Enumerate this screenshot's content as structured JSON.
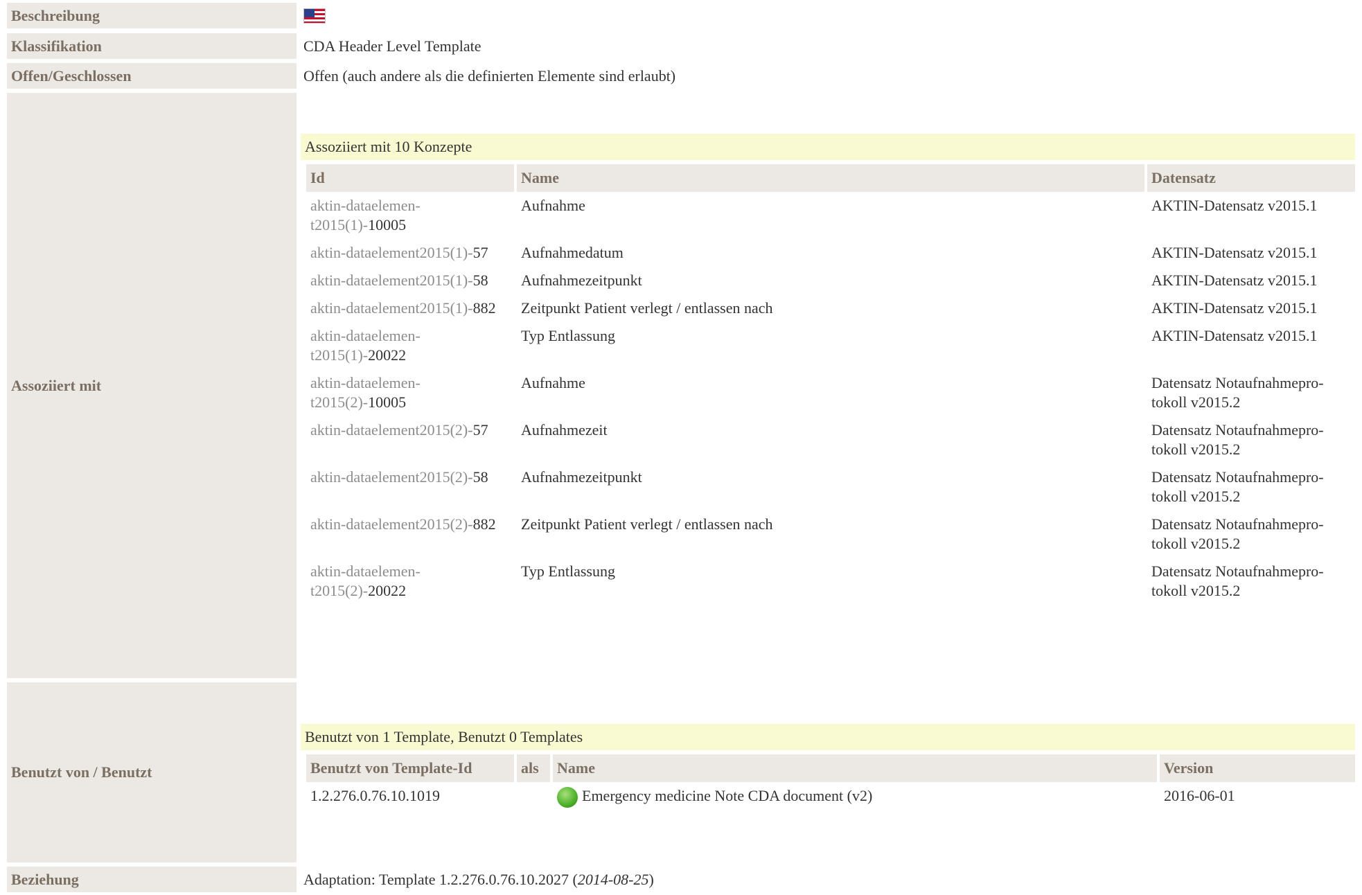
{
  "rows": {
    "beschreibung": {
      "label": "Beschreibung",
      "flag_icon": "us-flag-icon"
    },
    "klassifikation": {
      "label": "Klassifikation",
      "value": "CDA Header Level Template"
    },
    "offen": {
      "label": "Offen/Geschlossen",
      "value": "Offen (auch andere als die definierten Elemente sind erlaubt)"
    },
    "assoziiert": {
      "label": "Assoziiert mit"
    },
    "benutzt": {
      "label": "Benutzt von / Benutzt"
    },
    "beziehung": {
      "label": "Beziehung",
      "prefix": "Adaptation: Template 1.2.276.0.76.10.2027 (",
      "date": "2014-08-25",
      "suffix": ")"
    }
  },
  "concepts": {
    "caption": "Assoziiert mit 10 Konzepte",
    "headers": [
      "Id",
      "Name",
      "Datensatz"
    ],
    "items": [
      {
        "id_prefix": "aktin-dataelemen-",
        "id_break": "t2015(1)-",
        "id_num": "10005",
        "name": "Aufnahme",
        "dataset": "AKTIN-Datensatz v2015.1",
        "dataset2": ""
      },
      {
        "id_prefix": "aktin-dataelement2015(1)-",
        "id_break": "",
        "id_num": "57",
        "name": "Aufnahmedatum",
        "dataset": "AKTIN-Datensatz v2015.1",
        "dataset2": ""
      },
      {
        "id_prefix": "aktin-dataelement2015(1)-",
        "id_break": "",
        "id_num": "58",
        "name": "Aufnahmezeitpunkt",
        "dataset": "AKTIN-Datensatz v2015.1",
        "dataset2": ""
      },
      {
        "id_prefix": "aktin-dataelement2015(1)-",
        "id_break": "",
        "id_num": "882",
        "name": "Zeitpunkt Patient verlegt / entlassen nach",
        "dataset": "AKTIN-Datensatz v2015.1",
        "dataset2": ""
      },
      {
        "id_prefix": "aktin-dataelemen-",
        "id_break": "t2015(1)-",
        "id_num": "20022",
        "name": "Typ Entlassung",
        "dataset": "AKTIN-Datensatz v2015.1",
        "dataset2": ""
      },
      {
        "id_prefix": "aktin-dataelemen-",
        "id_break": "t2015(2)-",
        "id_num": "10005",
        "name": "Aufnahme",
        "dataset": "Datensatz Notaufnahmepro-",
        "dataset2": "tokoll v2015.2"
      },
      {
        "id_prefix": "aktin-dataelement2015(2)-",
        "id_break": "",
        "id_num": "57",
        "name": "Aufnahmezeit",
        "dataset": "Datensatz Notaufnahmepro-",
        "dataset2": "tokoll v2015.2"
      },
      {
        "id_prefix": "aktin-dataelement2015(2)-",
        "id_break": "",
        "id_num": "58",
        "name": "Aufnahmezeitpunkt",
        "dataset": "Datensatz Notaufnahmepro-",
        "dataset2": "tokoll v2015.2"
      },
      {
        "id_prefix": "aktin-dataelement2015(2)-",
        "id_break": "",
        "id_num": "882",
        "name": "Zeitpunkt Patient verlegt / entlassen nach",
        "dataset": "Datensatz Notaufnahmepro-",
        "dataset2": "tokoll v2015.2"
      },
      {
        "id_prefix": "aktin-dataelemen-",
        "id_break": "t2015(2)-",
        "id_num": "20022",
        "name": "Typ Entlassung",
        "dataset": "Datensatz Notaufnahmepro-",
        "dataset2": "tokoll v2015.2"
      }
    ]
  },
  "usage": {
    "caption": "Benutzt von 1 Template, Benutzt 0 Templates",
    "headers": [
      "Benutzt von Template-Id",
      "als",
      "Name",
      "Version"
    ],
    "items": [
      {
        "template_id": "1.2.276.0.76.10.1019",
        "als": "",
        "status_icon": "green-status-dot-icon",
        "name": "Emergency medicine Note CDA document (v2)",
        "version": "2016-06-01"
      }
    ]
  }
}
